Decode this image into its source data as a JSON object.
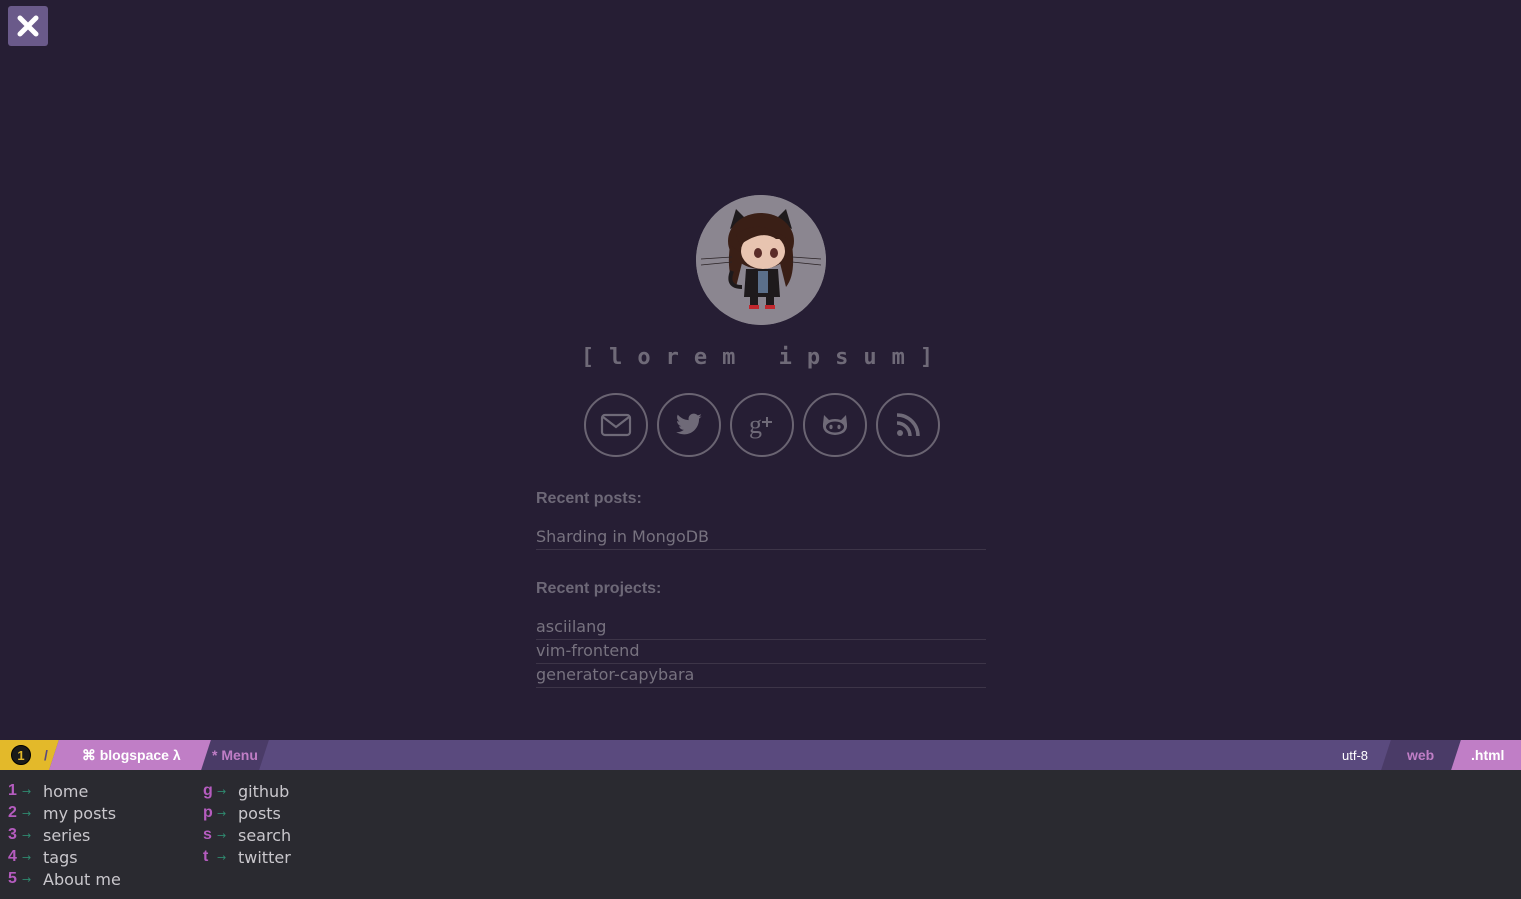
{
  "close_button": {
    "icon": "close-icon",
    "color": "#6a5a8a"
  },
  "profile": {
    "title": "[lorem ipsum]",
    "avatar": "octocat-avatar"
  },
  "socials": [
    {
      "name": "email",
      "icon": "envelope-icon"
    },
    {
      "name": "twitter",
      "icon": "twitter-icon"
    },
    {
      "name": "google-plus",
      "icon": "google-plus-icon"
    },
    {
      "name": "github",
      "icon": "github-icon"
    },
    {
      "name": "rss",
      "icon": "rss-icon"
    }
  ],
  "recent_posts": {
    "title": "Recent posts:",
    "items": [
      "Sharding in MongoDB"
    ]
  },
  "recent_projects": {
    "title": "Recent projects:",
    "items": [
      "asciilang",
      "vim-frontend",
      "generator-capybara"
    ]
  },
  "statusbar": {
    "buffer_number": "1",
    "separator": "/",
    "app_name": "⌘ blogspace λ",
    "mode": "* Menu",
    "encoding": "utf-8",
    "filetype": "web",
    "extension": ".html",
    "colors": {
      "bar": "#5a4a7e",
      "yellow": "#e3b92a",
      "pink": "#c07ec6"
    }
  },
  "menu": {
    "left": [
      {
        "key": "1",
        "label": "home"
      },
      {
        "key": "2",
        "label": "my posts"
      },
      {
        "key": "3",
        "label": "series"
      },
      {
        "key": "4",
        "label": "tags"
      },
      {
        "key": "5",
        "label": "About me"
      }
    ],
    "right": [
      {
        "key": "g",
        "label": "github"
      },
      {
        "key": "p",
        "label": "posts"
      },
      {
        "key": "s",
        "label": "search"
      },
      {
        "key": "t",
        "label": "twitter"
      }
    ],
    "arrow": "→"
  }
}
